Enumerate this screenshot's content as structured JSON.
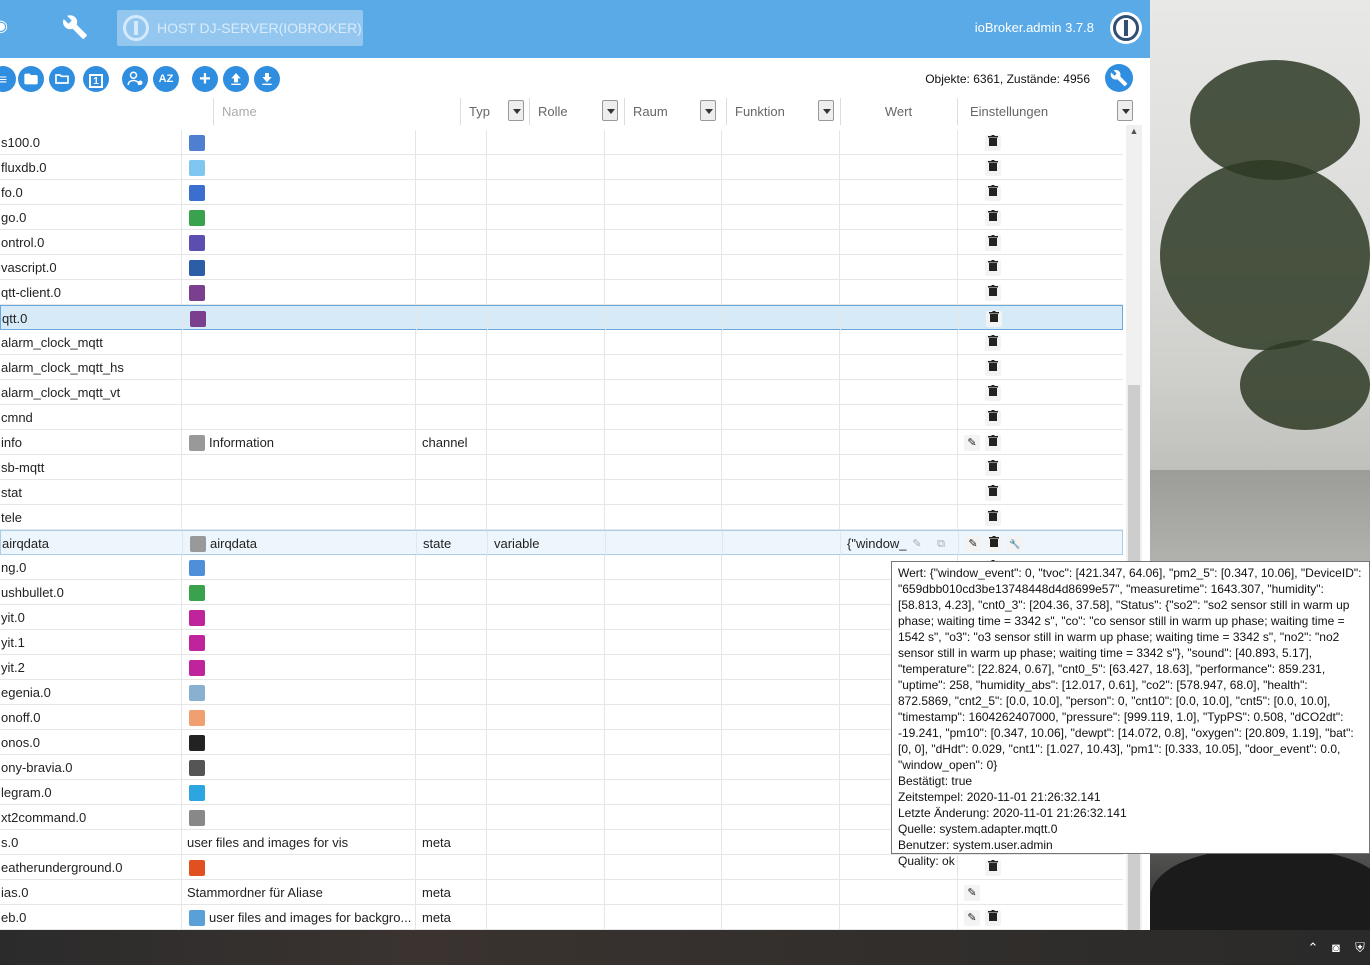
{
  "header": {
    "host_label": "HOST DJ-SERVER(IOBROKER)",
    "app_version": "ioBroker.admin 3.7.8"
  },
  "toolbar": {
    "stats": "Objekte: 6361, Zustände: 4956",
    "buttons": [
      "list-icon",
      "folder-icon",
      "folder-open-icon",
      "number-one-icon",
      "expert-mode-icon",
      "sort-az-icon",
      "add-icon",
      "upload-icon",
      "download-icon"
    ],
    "badge_one": "1",
    "sort_label": "AZ",
    "add_label": "+"
  },
  "columns": {
    "name_placeholder": "Name",
    "typ": "Typ",
    "rolle": "Rolle",
    "raum": "Raum",
    "funktion": "Funktion",
    "wert": "Wert",
    "einstellungen": "Einstellungen"
  },
  "rows": [
    {
      "id": "s100.0",
      "name": "",
      "typ": "",
      "rolle": "",
      "wert": "",
      "icon_color": "#4f7fd0"
    },
    {
      "id": "fluxdb.0",
      "name": "",
      "typ": "",
      "rolle": "",
      "wert": "",
      "icon_color": "#7fc7f0"
    },
    {
      "id": "fo.0",
      "name": "",
      "typ": "",
      "rolle": "",
      "wert": "",
      "icon_color": "#3a6fd0"
    },
    {
      "id": "go.0",
      "name": "",
      "typ": "",
      "rolle": "",
      "wert": "",
      "icon_color": "#3aa24c"
    },
    {
      "id": "ontrol.0",
      "name": "",
      "typ": "",
      "rolle": "",
      "wert": "",
      "icon_color": "#5a4fb0"
    },
    {
      "id": "vascript.0",
      "name": "",
      "typ": "",
      "rolle": "",
      "wert": "",
      "icon_color": "#2c5ea8"
    },
    {
      "id": "qtt-client.0",
      "name": "",
      "typ": "",
      "rolle": "",
      "wert": "",
      "icon_color": "#7a3f8f"
    },
    {
      "id": "qtt.0",
      "name": "",
      "typ": "",
      "rolle": "",
      "wert": "",
      "icon_color": "#7a3f8f"
    },
    {
      "id": "alarm_clock_mqtt",
      "name": "",
      "typ": "",
      "rolle": "",
      "wert": ""
    },
    {
      "id": "alarm_clock_mqtt_hs",
      "name": "",
      "typ": "",
      "rolle": "",
      "wert": ""
    },
    {
      "id": "alarm_clock_mqtt_vt",
      "name": "",
      "typ": "",
      "rolle": "",
      "wert": ""
    },
    {
      "id": "cmnd",
      "name": "",
      "typ": "",
      "rolle": "",
      "wert": ""
    },
    {
      "id": "info",
      "name": "Information",
      "typ": "channel",
      "rolle": "",
      "wert": "",
      "icon_color": "#999999"
    },
    {
      "id": "sb-mqtt",
      "name": "",
      "typ": "",
      "rolle": "",
      "wert": ""
    },
    {
      "id": "stat",
      "name": "",
      "typ": "",
      "rolle": "",
      "wert": ""
    },
    {
      "id": "tele",
      "name": "",
      "typ": "",
      "rolle": "",
      "wert": ""
    },
    {
      "id": "airqdata",
      "name": "airqdata",
      "typ": "state",
      "rolle": "variable",
      "wert": "{\"window_",
      "icon_color": "#999999"
    },
    {
      "id": "ng.0",
      "name": "",
      "typ": "",
      "rolle": "",
      "wert": "",
      "icon_color": "#4f8fd8"
    },
    {
      "id": "ushbullet.0",
      "name": "",
      "typ": "",
      "rolle": "",
      "wert": "",
      "icon_color": "#3aa24c"
    },
    {
      "id": "yit.0",
      "name": "",
      "typ": "",
      "rolle": "",
      "wert": "",
      "icon_color": "#c0249c"
    },
    {
      "id": "yit.1",
      "name": "",
      "typ": "",
      "rolle": "",
      "wert": "",
      "icon_color": "#c0249c"
    },
    {
      "id": "yit.2",
      "name": "",
      "typ": "",
      "rolle": "",
      "wert": "",
      "icon_color": "#c0249c"
    },
    {
      "id": "egenia.0",
      "name": "",
      "typ": "",
      "rolle": "",
      "wert": "",
      "icon_color": "#8ab0d0"
    },
    {
      "id": "onoff.0",
      "name": "",
      "typ": "",
      "rolle": "",
      "wert": "",
      "icon_color": "#f0a070"
    },
    {
      "id": "onos.0",
      "name": "",
      "typ": "",
      "rolle": "",
      "wert": "",
      "icon_color": "#222222"
    },
    {
      "id": "ony-bravia.0",
      "name": "",
      "typ": "",
      "rolle": "",
      "wert": "",
      "icon_color": "#555555"
    },
    {
      "id": "legram.0",
      "name": "",
      "typ": "",
      "rolle": "",
      "wert": "",
      "icon_color": "#2ca5e0"
    },
    {
      "id": "xt2command.0",
      "name": "",
      "typ": "",
      "rolle": "",
      "wert": "",
      "icon_color": "#888888"
    },
    {
      "id": "s.0",
      "name": "user files and images for vis",
      "typ": "meta",
      "rolle": "",
      "wert": ""
    },
    {
      "id": "eatherunderground.0",
      "name": "",
      "typ": "",
      "rolle": "",
      "wert": "",
      "icon_color": "#e05020"
    },
    {
      "id": "ias.0",
      "name": "Stammordner für Aliase",
      "typ": "meta",
      "rolle": "",
      "wert": ""
    },
    {
      "id": "eb.0",
      "name": "user files and images for backgro...",
      "typ": "meta",
      "rolle": "",
      "wert": "",
      "icon_color": "#5aa0d8"
    }
  ],
  "tooltip": {
    "wert": "Wert: {\"window_event\": 0, \"tvoc\": [421.347, 64.06], \"pm2_5\": [0.347, 10.06], \"DeviceID\": \"659dbb010cd3be13748448d4d8699e57\", \"measuretime\": 1643.307, \"humidity\": [58.813, 4.23], \"cnt0_3\": [204.36, 37.58], \"Status\": {\"so2\": \"so2 sensor still in warm up phase; waiting time = 3342 s\", \"co\": \"co sensor still in warm up phase; waiting time = 1542 s\", \"o3\": \"o3 sensor still in warm up phase; waiting time = 3342 s\", \"no2\": \"no2 sensor still in warm up phase; waiting time = 3342 s\"}, \"sound\": [40.893, 5.17], \"temperature\": [22.824, 0.67], \"cnt0_5\": [63.427, 18.63], \"performance\": 859.231, \"uptime\": 258, \"humidity_abs\": [12.017, 0.61], \"co2\": [578.947, 68.0], \"health\": 872.5869, \"cnt2_5\": [0.0, 10.0], \"person\": 0, \"cnt10\": [0.0, 10.0], \"cnt5\": [0.0, 10.0], \"timestamp\": 1604262407000, \"pressure\": [999.119, 1.0], \"TypPS\": 0.508, \"dCO2dt\": -19.241, \"pm10\": [0.347, 10.06], \"dewpt\": [14.072, 0.8], \"oxygen\": [20.809, 1.19], \"bat\": [0, 0], \"dHdt\": 0.029, \"cnt1\": [1.027, 10.43], \"pm1\": [0.333, 10.05], \"door_event\": 0.0, \"window_open\": 0}",
    "bestaetigt": "Bestätigt: true",
    "zeitstempel": "Zeitstempel: 2020-11-01 21:26:32.141",
    "letzte_aenderung": "Letzte Änderung: 2020-11-01 21:26:32.141",
    "quelle": "Quelle: system.adapter.mqtt.0",
    "benutzer": "Benutzer: system.user.admin",
    "quality": "Quality: ok"
  }
}
